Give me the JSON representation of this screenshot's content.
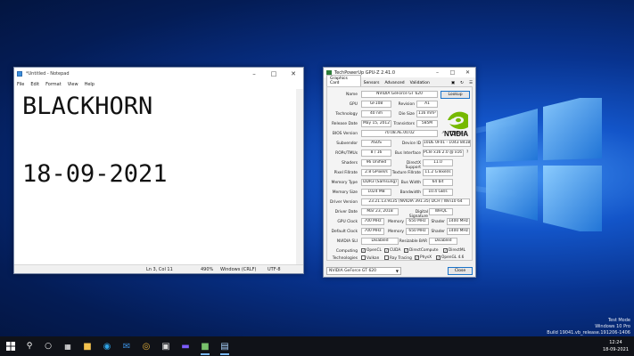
{
  "notepad": {
    "title": "*Untitled - Notepad",
    "menu": [
      "File",
      "Edit",
      "Format",
      "View",
      "Help"
    ],
    "lines": [
      "BLACKHORN",
      "18-09-2021"
    ],
    "status": {
      "position": "Ln 3, Col 11",
      "zoom": "490%",
      "line_ending": "Windows (CRLF)",
      "encoding": "UTF-8"
    }
  },
  "gpuz": {
    "title": "TechPowerUp GPU-Z 2.41.0",
    "tabs": [
      "Graphics Card",
      "Sensors",
      "Advanced",
      "Validation"
    ],
    "fields": {
      "name_label": "Name",
      "name": "NVIDIA GeForce GT 620",
      "lookup": "Lookup",
      "gpu_label": "GPU",
      "gpu": "GF108",
      "revision_label": "Revision",
      "revision": "A1",
      "tech_label": "Technology",
      "tech": "40 nm",
      "die_label": "Die Size",
      "die": "116 mm²",
      "release_label": "Release Date",
      "release": "May 15, 2012",
      "trans_label": "Transistors",
      "trans": "585M",
      "bios_label": "BIOS Version",
      "bios": "70.08.AE.00.02",
      "uefi": "UEFI",
      "subvendor_label": "Subvendor",
      "subvendor": "ASUS",
      "device_label": "Device ID",
      "device": "10DE 0F01 - 1043 8418",
      "rops_label": "ROPs/TMUs",
      "rops": "8 / 16",
      "bus_label": "Bus Interface",
      "bus": "PCIe x16 2.0 @ x16 2.0",
      "bus_help": "?",
      "shaders_label": "Shaders",
      "shaders": "96 Unified",
      "dx_label": "DirectX Support",
      "dx": "11.0",
      "pixel_label": "Pixel Fillrate",
      "pixel": "2.8 GPixel/s",
      "texture_label": "Texture Fillrate",
      "texture": "11.2 GTexel/s",
      "memtype_label": "Memory Type",
      "memtype": "DDR3 (Samsung)",
      "buswidth_label": "Bus Width",
      "buswidth": "64 bit",
      "memsize_label": "Memory Size",
      "memsize": "1024 MB",
      "bandwidth_label": "Bandwidth",
      "bandwidth": "10.4 GB/s",
      "driver_label": "Driver Version",
      "driver": "23.21.13.9135 (NVIDIA 391.35) DCH / Win10 64",
      "driverdate_label": "Driver Date",
      "driverdate": "Mar 23, 2018",
      "digsig_label": "Digital Signature",
      "digsig": "WHQL",
      "gpuclock_label": "GPU Clock",
      "gpuclock": "700 MHz",
      "mem_label": "Memory",
      "memclock": "650 MHz",
      "shader_label": "Shader",
      "shaderclock": "1400 MHz",
      "defclock_label": "Default Clock",
      "defclock": "700 MHz",
      "defmem": "650 MHz",
      "defshader": "1400 MHz",
      "sli_label": "NVIDIA SLI",
      "sli": "Disabled",
      "rebar_label": "Resizable BAR",
      "rebar": "Disabled",
      "computing_label": "Computing",
      "technologies_label": "Technologies"
    },
    "computing": [
      "OpenCL",
      "CUDA",
      "DirectCompute",
      "DirectML"
    ],
    "technologies": [
      "Vulkan",
      "Ray Tracing",
      "PhysX",
      "OpenGL 4.6"
    ],
    "logo": "NVIDIA",
    "selected_card": "NVIDIA GeForce GT 620",
    "close": "Close"
  },
  "watermark": {
    "line1": "Test Mode",
    "line2": "Windows 10 Pro",
    "line3": "Build 19041.vb_release.191206-1406"
  },
  "clock": {
    "time": "12:24",
    "date": "18-09-2021"
  }
}
